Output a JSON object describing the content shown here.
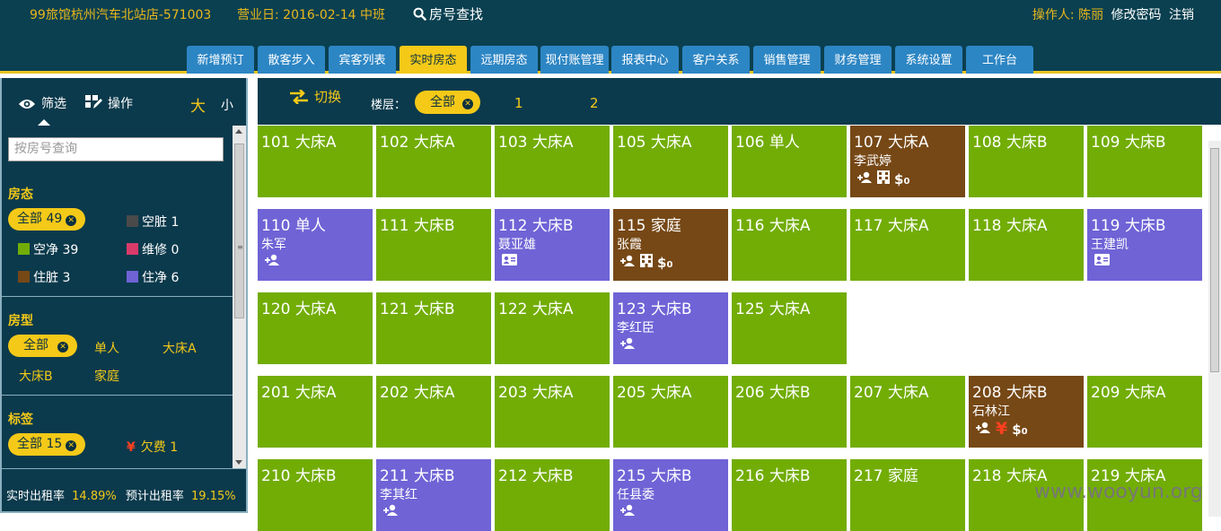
{
  "topbar": {
    "shop": "99旅馆杭州汽车北站店-571003",
    "business_day": "营业日: 2016-02-14 中班",
    "search_label": "房号查找",
    "operator_label": "操作人: 陈丽",
    "change_password": "修改密码",
    "logout": "注销"
  },
  "nav": {
    "tabs": [
      {
        "label": "新增预订"
      },
      {
        "label": "散客步入"
      },
      {
        "label": "宾客列表"
      },
      {
        "label": "实时房态",
        "active": true
      },
      {
        "label": "远期房态"
      },
      {
        "label": "现付账管理"
      },
      {
        "label": "报表中心"
      },
      {
        "label": "客户关系"
      },
      {
        "label": "销售管理"
      },
      {
        "label": "财务管理"
      },
      {
        "label": "系统设置"
      },
      {
        "label": "工作台"
      }
    ]
  },
  "sidebar": {
    "tab_filter": "筛选",
    "tab_action": "操作",
    "size_big": "大",
    "size_small": "小",
    "search_placeholder": "按房号查询",
    "status": {
      "title": "房态",
      "all": "全部 49",
      "items": [
        {
          "label": "空脏 1",
          "color": "#4a4a4a"
        },
        {
          "label": "空净 39",
          "color": "#72ad06"
        },
        {
          "label": "维修 0",
          "color": "#d93a6a"
        },
        {
          "label": "住脏 3",
          "color": "#764816"
        },
        {
          "label": "住净 6",
          "color": "#6f63d6"
        }
      ]
    },
    "room_type": {
      "title": "房型",
      "all": "全部",
      "items": [
        "单人",
        "大床A",
        "大床B",
        "家庭"
      ]
    },
    "tags": {
      "title": "标签",
      "all": "全部 15",
      "arrears_icon": "¥",
      "arrears": "欠费 1"
    },
    "footer": {
      "realtime_label": "实时出租率",
      "realtime_value": "14.89%",
      "forecast_label": "预计出租率",
      "forecast_value": "19.15%"
    }
  },
  "main": {
    "switch_label": "切换",
    "floor_label": "楼层：",
    "floor_all": "全部",
    "floors": [
      "1",
      "2"
    ],
    "colors": {
      "vacant_clean": "#72ad06",
      "occupied_clean": "#6f63d6",
      "occupied_dirty": "#764816"
    },
    "rooms": [
      {
        "title": "101 大床A",
        "state": "g"
      },
      {
        "title": "102 大床A",
        "state": "g"
      },
      {
        "title": "103 大床A",
        "state": "g"
      },
      {
        "title": "105 大床A",
        "state": "g"
      },
      {
        "title": "106 单人",
        "state": "g"
      },
      {
        "title": "107 大床A",
        "state": "b",
        "guest": "李武婷",
        "icons": [
          "add-guest-icon",
          "building-icon",
          "dollar-zero-icon"
        ]
      },
      {
        "title": "108 大床B",
        "state": "g"
      },
      {
        "title": "109 大床B",
        "state": "g"
      },
      {
        "title": "110 单人",
        "state": "p",
        "guest": "朱军",
        "icons": [
          "add-guest-icon"
        ]
      },
      {
        "title": "111 大床B",
        "state": "g"
      },
      {
        "title": "112 大床B",
        "state": "p",
        "guest": "聂亚雄",
        "icons": [
          "id-card-icon"
        ]
      },
      {
        "title": "115 家庭",
        "state": "b",
        "guest": "张霞",
        "icons": [
          "add-guest-icon",
          "building-icon",
          "dollar-zero-icon"
        ]
      },
      {
        "title": "116 大床A",
        "state": "g"
      },
      {
        "title": "117 大床A",
        "state": "g"
      },
      {
        "title": "118 大床A",
        "state": "g"
      },
      {
        "title": "119 大床B",
        "state": "p",
        "guest": "王建凯",
        "icons": [
          "id-card-icon"
        ]
      },
      {
        "title": "120 大床A",
        "state": "g"
      },
      {
        "title": "121 大床B",
        "state": "g"
      },
      {
        "title": "122 大床A",
        "state": "g"
      },
      {
        "title": "123 大床B",
        "state": "p",
        "guest": "李红臣",
        "icons": [
          "add-guest-icon"
        ]
      },
      {
        "title": "125 大床A",
        "state": "g"
      },
      {
        "title": "201 大床A",
        "state": "g"
      },
      {
        "title": "202 大床A",
        "state": "g"
      },
      {
        "title": "203 大床A",
        "state": "g"
      },
      {
        "title": "205 大床A",
        "state": "g"
      },
      {
        "title": "206 大床B",
        "state": "g"
      },
      {
        "title": "207 大床A",
        "state": "g"
      },
      {
        "title": "208 大床B",
        "state": "b",
        "guest": "石林江",
        "icons": [
          "add-guest-icon",
          "yen-icon",
          "dollar-zero-icon"
        ]
      },
      {
        "title": "209 大床A",
        "state": "g"
      },
      {
        "title": "210 大床B",
        "state": "g"
      },
      {
        "title": "211 大床B",
        "state": "p",
        "guest": "李其红",
        "icons": [
          "add-guest-icon"
        ]
      },
      {
        "title": "212 大床B",
        "state": "g"
      },
      {
        "title": "215 大床B",
        "state": "p",
        "guest": "任县委",
        "icons": [
          "add-guest-icon"
        ]
      },
      {
        "title": "216 大床B",
        "state": "g"
      },
      {
        "title": "217 家庭",
        "state": "g"
      },
      {
        "title": "218 大床A",
        "state": "g"
      },
      {
        "title": "219 大床A",
        "state": "g"
      }
    ]
  },
  "watermark": "www.wooyun.org"
}
